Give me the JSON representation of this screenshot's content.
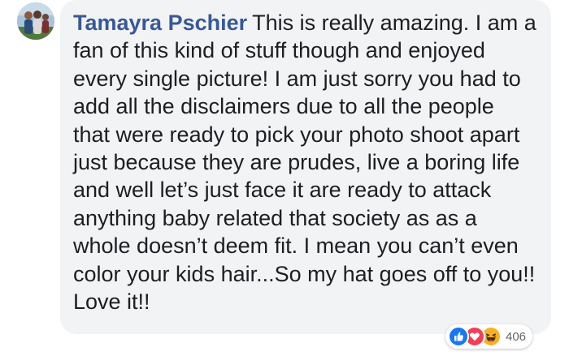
{
  "comment": {
    "author": "Tamayra Pschier",
    "text": "This is really amazing. I am a fan of this kind of stuff though and enjoyed every single picture! I am just sorry you had to add all the disclaimers due to all the people that were ready to pick your photo shoot apart just because they are prudes, live a boring life and well let’s just face it are ready to attack anything baby related that society as as a whole doesn’t deem fit. I mean you can’t even color your kids hair...So my hat goes off to you!! Love it!!"
  },
  "reactions": {
    "icons": [
      "like-icon",
      "love-icon",
      "haha-icon"
    ],
    "count": "406"
  },
  "colors": {
    "author_name": "#385898",
    "bubble_background": "#f2f3f5",
    "body_text": "#1c1e21",
    "like": "#1877f2",
    "love": "#f33e58",
    "haha": "#f7b125"
  }
}
